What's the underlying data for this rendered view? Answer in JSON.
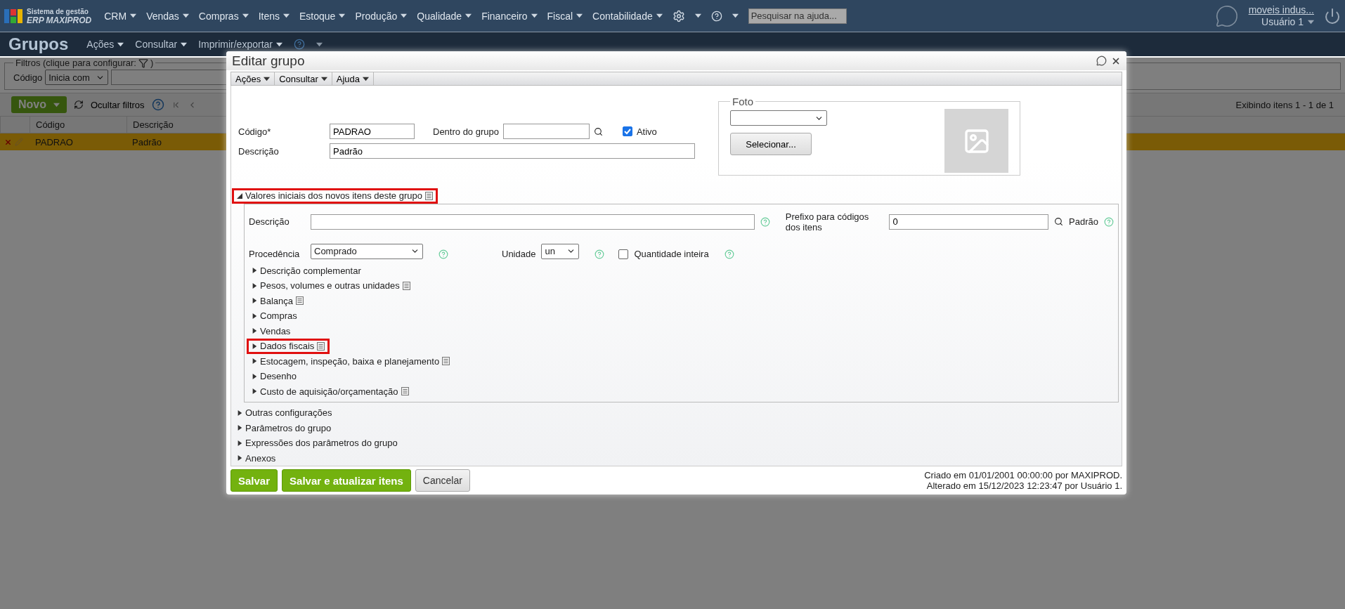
{
  "app": {
    "logo_line_1": "Sistema de gestão",
    "logo_line_2": "ERP MAXIPROD"
  },
  "top_menu": [
    "CRM",
    "Vendas",
    "Compras",
    "Itens",
    "Estoque",
    "Produção",
    "Qualidade",
    "Financeiro",
    "Fiscal",
    "Contabilidade"
  ],
  "help_search": {
    "placeholder": "Pesquisar na ajuda..."
  },
  "user": {
    "company": "moveis indus...",
    "name": "Usuário 1"
  },
  "page": {
    "title": "Grupos",
    "menu": [
      "Ações",
      "Consultar",
      "Imprimir/exportar"
    ]
  },
  "filters": {
    "legend": "Filtros (clique para configurar:",
    "legend_end": ")",
    "field_label": "Código",
    "operator": "Inicia com"
  },
  "toolbar": {
    "new_button": "Novo",
    "hide_filters": "Ocultar filtros",
    "paging": "Exibindo itens 1 - 1 de 1"
  },
  "table": {
    "columns": [
      "Código",
      "Descrição"
    ],
    "rows": [
      {
        "cells": [
          "PADRAO",
          "Padrão"
        ],
        "selected": true
      }
    ]
  },
  "dialog": {
    "title": "Editar grupo",
    "menu": [
      "Ações",
      "Consultar",
      "Ajuda"
    ],
    "fields": {
      "code_label": "Código*",
      "code_value": "PADRAO",
      "parent_label": "Dentro do grupo",
      "active_label": "Ativo",
      "active_checked": true,
      "description_label": "Descrição",
      "description_value": "Padrão"
    },
    "photo": {
      "legend": "Foto",
      "button": "Selecionar..."
    },
    "sections": [
      {
        "label": "Valores iniciais dos novos itens deste grupo",
        "expanded": true,
        "highlighted": true,
        "note": true,
        "content": {
          "description_label": "Descrição",
          "prefix_label": "Prefixo para códigos dos itens",
          "prefix_value": "0",
          "prefix_default": "Padrão",
          "origin_label": "Procedência",
          "origin_value": "Comprado",
          "unit_label": "Unidade",
          "unit_value": "un",
          "integer_label": "Quantidade inteira",
          "integer_checked": false
        },
        "children": [
          {
            "label": "Descrição complementar",
            "expanded": false,
            "highlighted": false,
            "note": false
          },
          {
            "label": "Pesos, volumes e outras unidades",
            "expanded": false,
            "highlighted": false,
            "note": true
          },
          {
            "label": "Balança",
            "expanded": false,
            "highlighted": false,
            "note": true
          },
          {
            "label": "Compras",
            "expanded": false,
            "highlighted": false,
            "note": false
          },
          {
            "label": "Vendas",
            "expanded": false,
            "highlighted": false,
            "note": false
          },
          {
            "label": "Dados fiscais",
            "expanded": false,
            "highlighted": true,
            "note": true
          },
          {
            "label": "Estocagem, inspeção, baixa e planejamento",
            "expanded": false,
            "highlighted": false,
            "note": true
          },
          {
            "label": "Desenho",
            "expanded": false,
            "highlighted": false,
            "note": false
          },
          {
            "label": "Custo de aquisição/orçamentação",
            "expanded": false,
            "highlighted": false,
            "note": true
          }
        ]
      },
      {
        "label": "Outras configurações",
        "expanded": false,
        "highlighted": false,
        "note": false
      },
      {
        "label": "Parâmetros do grupo",
        "expanded": false,
        "highlighted": false,
        "note": false
      },
      {
        "label": "Expressões dos parâmetros do grupo",
        "expanded": false,
        "highlighted": false,
        "note": false
      },
      {
        "label": "Anexos",
        "expanded": false,
        "highlighted": false,
        "note": false
      }
    ],
    "buttons": [
      {
        "label": "Salvar",
        "kind": "primary"
      },
      {
        "label": "Salvar e atualizar itens",
        "kind": "primary"
      },
      {
        "label": "Cancelar",
        "kind": "secondary"
      }
    ],
    "created": "Criado em 01/01/2001 00:00:00 por MAXIPROD.",
    "modified": "Alterado em 15/12/2023 12:23:47 por Usuário 1."
  }
}
